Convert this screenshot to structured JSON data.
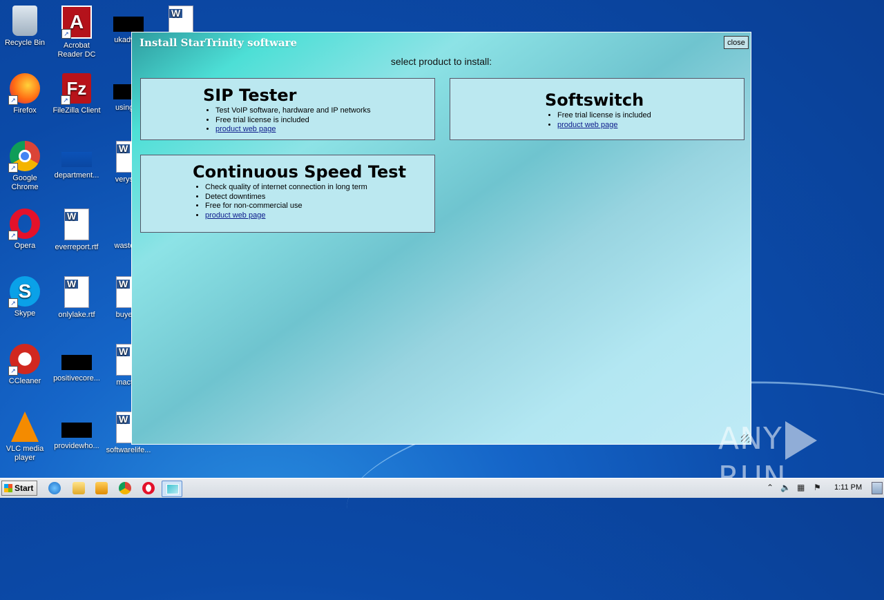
{
  "desktop": {
    "icons": [
      {
        "label": "Recycle Bin",
        "icon": "recycle-bin-icon"
      },
      {
        "label": "Acrobat Reader DC",
        "icon": "acrobat-icon"
      },
      {
        "label": "ukadvan",
        "icon": "blank-icon"
      },
      {
        "label": "",
        "icon": "word-doc-icon"
      },
      {
        "label": "Firefox",
        "icon": "firefox-icon"
      },
      {
        "label": "FileZilla Client",
        "icon": "filezilla-icon"
      },
      {
        "label": "usingac",
        "icon": "blank-icon"
      },
      {
        "label": "Google Chrome",
        "icon": "chrome-icon"
      },
      {
        "label": "department...",
        "icon": "blank-icon"
      },
      {
        "label": "verysen",
        "icon": "word-doc-icon"
      },
      {
        "label": "Opera",
        "icon": "opera-icon"
      },
      {
        "label": "everreport.rtf",
        "icon": "word-doc-icon"
      },
      {
        "label": "wasteho",
        "icon": "blank-icon"
      },
      {
        "label": "Skype",
        "icon": "skype-icon"
      },
      {
        "label": "onlylake.rtf",
        "icon": "word-doc-icon"
      },
      {
        "label": "buyerth",
        "icon": "word-doc-icon"
      },
      {
        "label": "CCleaner",
        "icon": "ccleaner-icon"
      },
      {
        "label": "positivecore...",
        "icon": "blank-icon"
      },
      {
        "label": "mactov",
        "icon": "word-doc-icon"
      },
      {
        "label": "VLC media player",
        "icon": "vlc-icon"
      },
      {
        "label": "providewho...",
        "icon": "blank-icon"
      },
      {
        "label": "softwarelife...",
        "icon": "word-doc-icon"
      }
    ]
  },
  "dialog": {
    "title": "Install StarTrinity software",
    "close_label": "close",
    "subtitle": "select product to install:",
    "products": [
      {
        "name": "SIP Tester",
        "features": [
          "Test VoIP software, hardware and IP networks",
          "Free trial license is included"
        ],
        "link": "product web page"
      },
      {
        "name": "Softswitch",
        "features": [
          "Free trial license is included"
        ],
        "link": "product web page"
      },
      {
        "name": "Continuous Speed Test",
        "features": [
          "Check quality of internet connection in long term",
          "Detect downtimes",
          "Free for non-commercial use"
        ],
        "link": "product web page"
      }
    ]
  },
  "watermark": {
    "left": "ANY",
    "right": "RUN"
  },
  "taskbar": {
    "start_label": "Start",
    "clock": "1:11 PM"
  }
}
